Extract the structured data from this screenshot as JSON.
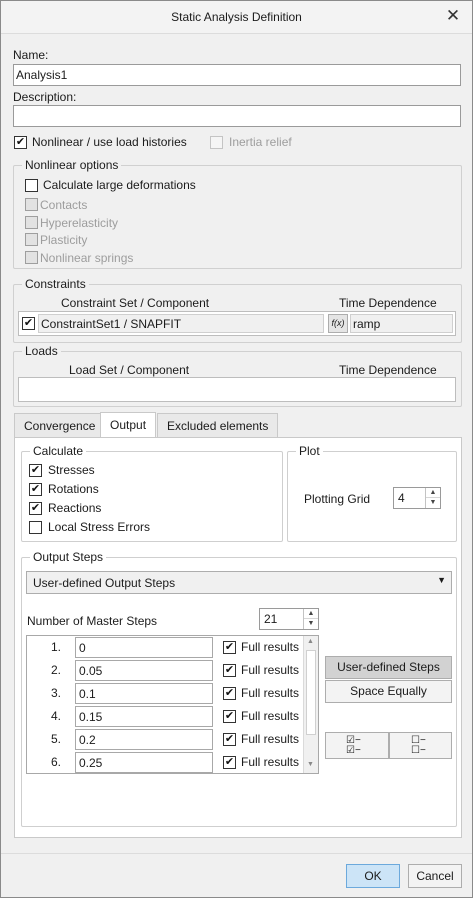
{
  "window": {
    "title": "Static Analysis Definition"
  },
  "name": {
    "label": "Name:",
    "value": "Analysis1"
  },
  "description": {
    "label": "Description:",
    "value": ""
  },
  "nonlinear_checkbox": {
    "label": "Nonlinear / use load histories",
    "checked": true
  },
  "inertia_relief": {
    "label": "Inertia relief",
    "enabled": false
  },
  "nonlinear_options": {
    "title": "Nonlinear options",
    "large_deformations": "Calculate large deformations",
    "items": [
      "Contacts",
      "Hyperelasticity",
      "Plasticity",
      "Nonlinear springs"
    ]
  },
  "constraints": {
    "title": "Constraints",
    "col_set": "Constraint Set / Component",
    "col_time": "Time Dependence",
    "row_value": "ConstraintSet1 / SNAPFIT",
    "fx_symbol": "f(x)",
    "time_value": "ramp"
  },
  "loads": {
    "title": "Loads",
    "col_set": "Load Set / Component",
    "col_time": "Time Dependence"
  },
  "tabs": {
    "convergence": "Convergence",
    "output": "Output",
    "excluded": "Excluded elements"
  },
  "calculate": {
    "title": "Calculate",
    "stresses": "Stresses",
    "rotations": "Rotations",
    "reactions": "Reactions",
    "local_stress": "Local Stress Errors"
  },
  "plot": {
    "title": "Plot",
    "grid_label": "Plotting Grid",
    "grid_value": "4"
  },
  "output_steps": {
    "title": "Output Steps",
    "dropdown_value": "User-defined Output Steps",
    "master_label": "Number of Master Steps",
    "master_value": "21",
    "full_results_label": "Full results",
    "rows": [
      {
        "num": "1.",
        "value": "0"
      },
      {
        "num": "2.",
        "value": "0.05"
      },
      {
        "num": "3.",
        "value": "0.1"
      },
      {
        "num": "4.",
        "value": "0.15"
      },
      {
        "num": "5.",
        "value": "0.2"
      },
      {
        "num": "6.",
        "value": "0.25"
      }
    ],
    "btn_user_defined": "User-defined Steps",
    "btn_space_equally": "Space Equally"
  },
  "footer": {
    "ok": "OK",
    "cancel": "Cancel"
  }
}
